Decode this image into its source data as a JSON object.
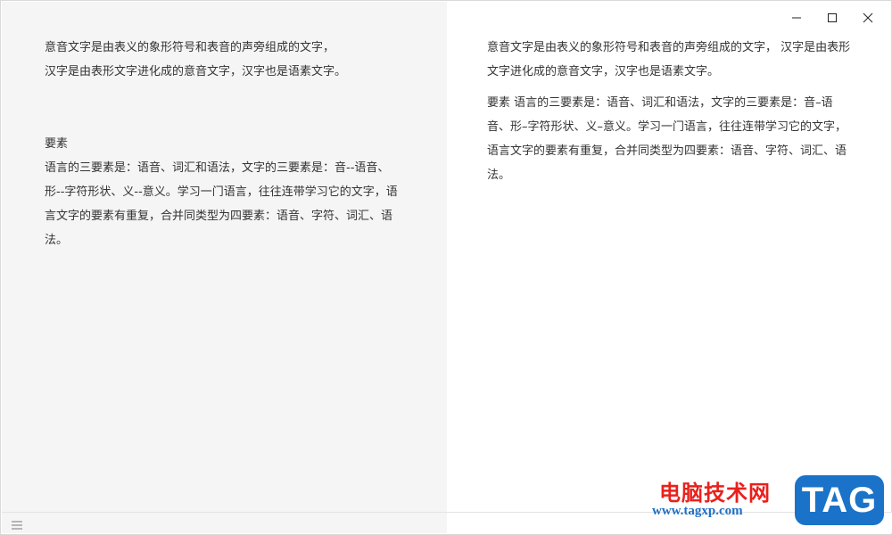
{
  "editor": {
    "text": "意音文字是由表义的象形符号和表音的声旁组成的文字，\n汉字是由表形文字进化成的意音文字，汉字也是语素文字。\n\n\n要素\n语言的三要素是：语音、词汇和语法，文字的三要素是：音--语音、形--字符形状、义--意义。学习一门语言，往往连带学习它的文字，语言文字的要素有重复，合并同类型为四要素：语音、字符、词汇、语法。"
  },
  "preview": {
    "paragraph_1": "意音文字是由表义的象形符号和表音的声旁组成的文字， 汉字是由表形文字进化成的意音文字，汉字也是语素文字。",
    "paragraph_2": "要素 语言的三要素是：语音、词汇和语法，文字的三要素是：音–语音、形–字符形状、义–意义。学习一门语言，往往连带学习它的文字，语言文字的要素有重复，合并同类型为四要素：语音、字符、词汇、语法。"
  },
  "window_controls": {
    "minimize_icon": "minimize-icon",
    "maximize_icon": "maximize-icon",
    "close_icon": "close-icon"
  },
  "status_bar": {
    "menu_icon": "hamburger-menu-icon"
  },
  "watermark": {
    "site_name": "电脑技术网",
    "url": "www.tagxp.com",
    "tag": "TAG"
  },
  "colors": {
    "editor_bg": "#f5f5f5",
    "text": "#333333",
    "watermark_red": "#e8211c",
    "watermark_blue": "#1a73c9"
  }
}
